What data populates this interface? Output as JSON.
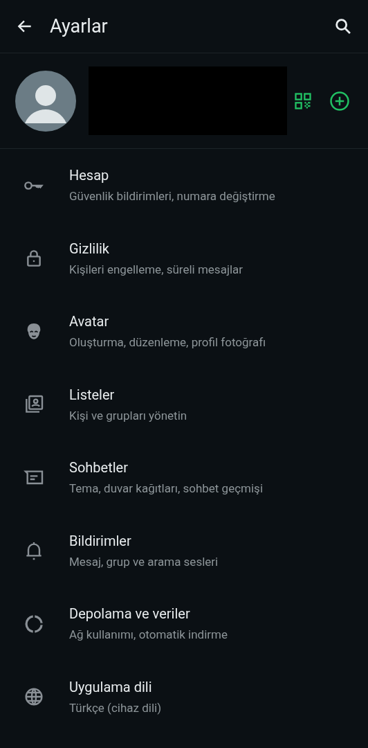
{
  "header": {
    "title": "Ayarlar"
  },
  "items": [
    {
      "kind": "key",
      "title": "Hesap",
      "subtitle": "Güvenlik bildirimleri, numara değiştirme"
    },
    {
      "kind": "lock",
      "title": "Gizlilik",
      "subtitle": "Kişileri engelleme, süreli mesajlar"
    },
    {
      "kind": "avatar",
      "title": "Avatar",
      "subtitle": "Oluşturma, düzenleme, profil fotoğrafı"
    },
    {
      "kind": "lists",
      "title": "Listeler",
      "subtitle": "Kişi ve grupları yönetin"
    },
    {
      "kind": "chat",
      "title": "Sohbetler",
      "subtitle": "Tema, duvar kağıtları, sohbet geçmişi"
    },
    {
      "kind": "bell",
      "title": "Bildirimler",
      "subtitle": "Mesaj, grup ve arama sesleri"
    },
    {
      "kind": "storage",
      "title": "Depolama ve veriler",
      "subtitle": "Ağ kullanımı, otomatik indirme"
    },
    {
      "kind": "globe",
      "title": "Uygulama dili",
      "subtitle": "Türkçe (cihaz dili)"
    }
  ]
}
